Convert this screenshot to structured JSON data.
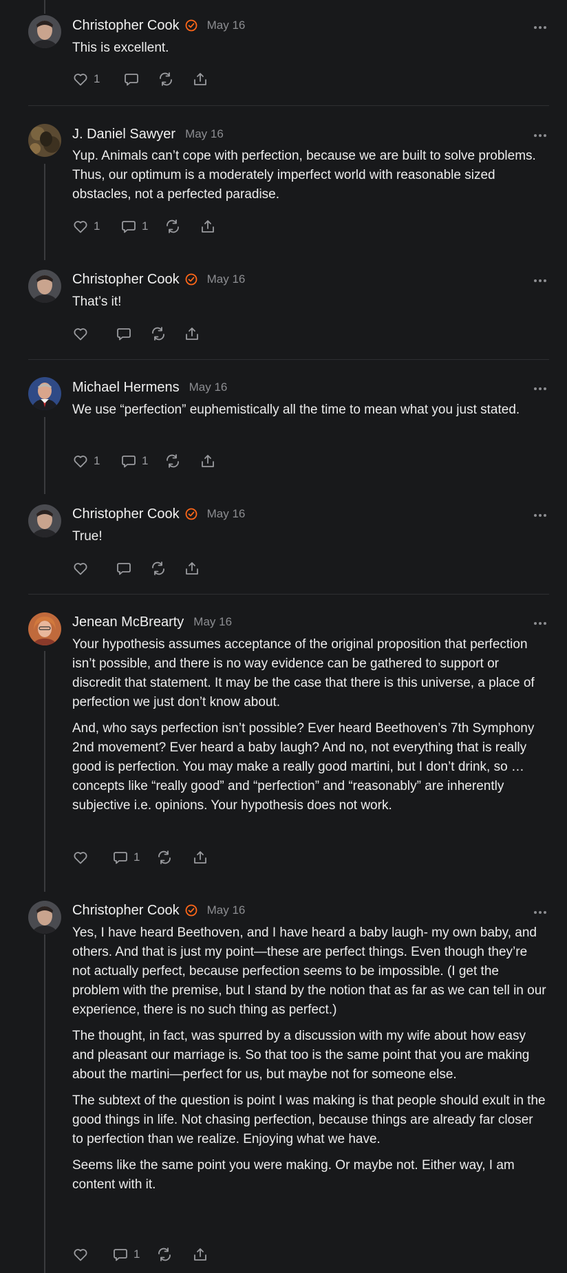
{
  "comments": [
    {
      "name": "Christopher Cook",
      "verified": true,
      "date": "May 16",
      "paragraphs": [
        "This is excellent."
      ],
      "likes": "1",
      "replies": ""
    },
    {
      "name": "J. Daniel Sawyer",
      "verified": false,
      "date": "May 16",
      "paragraphs": [
        "Yup. Animals can’t cope with perfection, because we are built to solve problems. Thus, our optimum is a moderately imperfect world with reasonable sized obstacles, not a perfected paradise."
      ],
      "likes": "1",
      "replies": "1"
    },
    {
      "name": "Christopher Cook",
      "verified": true,
      "date": "May 16",
      "paragraphs": [
        "That’s it!"
      ],
      "likes": "",
      "replies": ""
    },
    {
      "name": "Michael Hermens",
      "verified": false,
      "date": "May 16",
      "paragraphs": [
        "We use “perfection” euphemistically all the time to mean what you just stated."
      ],
      "likes": "1",
      "replies": "1"
    },
    {
      "name": "Christopher Cook",
      "verified": true,
      "date": "May 16",
      "paragraphs": [
        "True!"
      ],
      "likes": "",
      "replies": ""
    },
    {
      "name": "Jenean McBrearty",
      "verified": false,
      "date": "May 16",
      "paragraphs": [
        "Your hypothesis assumes acceptance of the original proposition that perfection isn’t possible, and there is no way evidence can be gathered to support or discredit that statement. It may be the case that there is this universe, a place of perfection we just don’t know about.",
        "And, who says perfection isn’t possible? Ever heard Beethoven’s 7th Symphony 2nd movement? Ever heard a baby laugh? And no, not everything that is really good is perfection. You may make a really good martini, but I don’t drink, so …concepts like “really good” and “perfection” and “reasonably” are inherently subjective i.e. opinions. Your hypothesis does not work."
      ],
      "likes": "",
      "replies": "1"
    },
    {
      "name": "Christopher Cook",
      "verified": true,
      "date": "May 16",
      "paragraphs": [
        "Yes, I have heard Beethoven, and I have heard a baby laugh- my own baby, and others. And that is just my point—these are perfect things. Even though they’re not actually perfect, because perfection seems to be impossible. (I get the problem with the premise, but I stand by the notion that as far as we can tell in our experience, there is no such thing as perfect.)",
        "The thought, in fact, was spurred by a discussion with my wife about how easy and pleasant our marriage is. So that too is the same point that you are making about the martini—perfect for us, but maybe not for someone else.",
        "The subtext of the question is point I was making is that people should exult in the good things in life. Not chasing perfection, because things are already far closer to perfection than we realize. Enjoying what we have.",
        "Seems like the same point you were making. Or maybe not. Either way, I am content with it."
      ],
      "likes": "",
      "replies": "1"
    }
  ],
  "colors": {
    "accent": "#ff6719",
    "background": "#18191b"
  },
  "icons": [
    "heart-icon",
    "comment-icon",
    "restack-icon",
    "share-icon",
    "more-icon",
    "verified-icon"
  ]
}
